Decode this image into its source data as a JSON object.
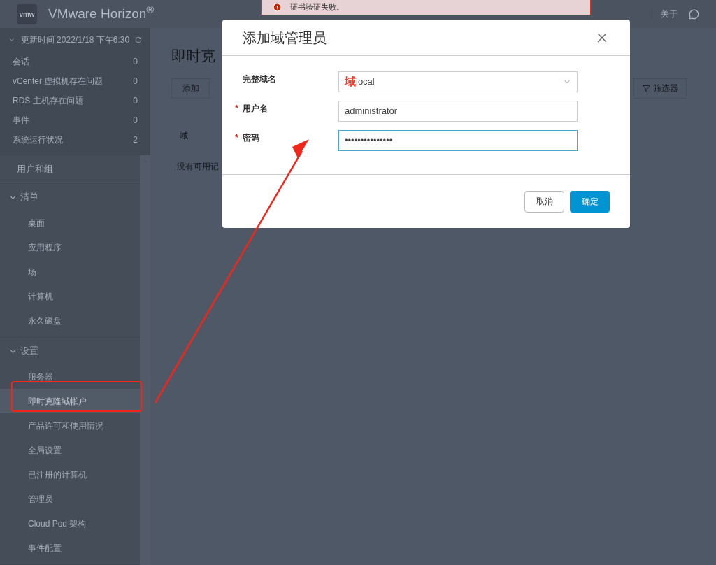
{
  "header": {
    "logo": "vmw",
    "product": "VMware Horizon$^{®}$",
    "links": [
      "关于"
    ]
  },
  "alert": {
    "message": "证书验证失败。"
  },
  "summary": {
    "title": "更新时间 2022/1/18 下午6:30",
    "expanded": true,
    "rows": [
      {
        "label": "会话",
        "count": "0"
      },
      {
        "label": "vCenter 虚拟机存在问题",
        "count": "0"
      },
      {
        "label": "RDS 主机存在问题",
        "count": "0"
      },
      {
        "label": "事件",
        "count": "0"
      },
      {
        "label": "系统运行状况",
        "count": "2"
      }
    ]
  },
  "nav": [
    {
      "kind": "link",
      "label": "用户和组",
      "selected": false
    },
    {
      "kind": "group",
      "label": "清单",
      "expanded": true,
      "children": [
        {
          "label": "桌面",
          "selected": false
        },
        {
          "label": "应用程序",
          "selected": false
        },
        {
          "label": "场",
          "selected": false
        },
        {
          "label": "计算机",
          "selected": false
        },
        {
          "label": "永久磁盘",
          "selected": false
        }
      ]
    },
    {
      "kind": "group",
      "label": "设置",
      "expanded": true,
      "children": [
        {
          "label": "服务器",
          "selected": false
        },
        {
          "label": "即时克隆域帐户",
          "selected": true
        },
        {
          "label": "产品许可和使用情况",
          "selected": false
        },
        {
          "label": "全局设置",
          "selected": false
        },
        {
          "label": "已注册的计算机",
          "selected": false
        },
        {
          "label": "管理员",
          "selected": false
        },
        {
          "label": "Cloud Pod 架构",
          "selected": false
        },
        {
          "label": "事件配置",
          "selected": false
        }
      ]
    }
  ],
  "main": {
    "title": "即时克",
    "add_button": "添加",
    "filter_button": "筛选器",
    "table": {
      "columns": [
        "域"
      ],
      "empty_text": "没有可用记"
    }
  },
  "dialog": {
    "title": "添加域管理员",
    "required_mark": "*",
    "fields": [
      {
        "kind": "select",
        "label": "完整域名",
        "required": false,
        "focused": false,
        "annotation": "域",
        "value": "local"
      },
      {
        "kind": "text",
        "label": "用户名",
        "required": true,
        "focused": false,
        "value": "administrator"
      },
      {
        "kind": "password",
        "label": "密码",
        "required": true,
        "focused": true,
        "value": "•••••••••••••••"
      }
    ],
    "buttons": [
      {
        "label": "取消",
        "primary": false
      },
      {
        "label": "确定",
        "primary": true
      }
    ]
  }
}
